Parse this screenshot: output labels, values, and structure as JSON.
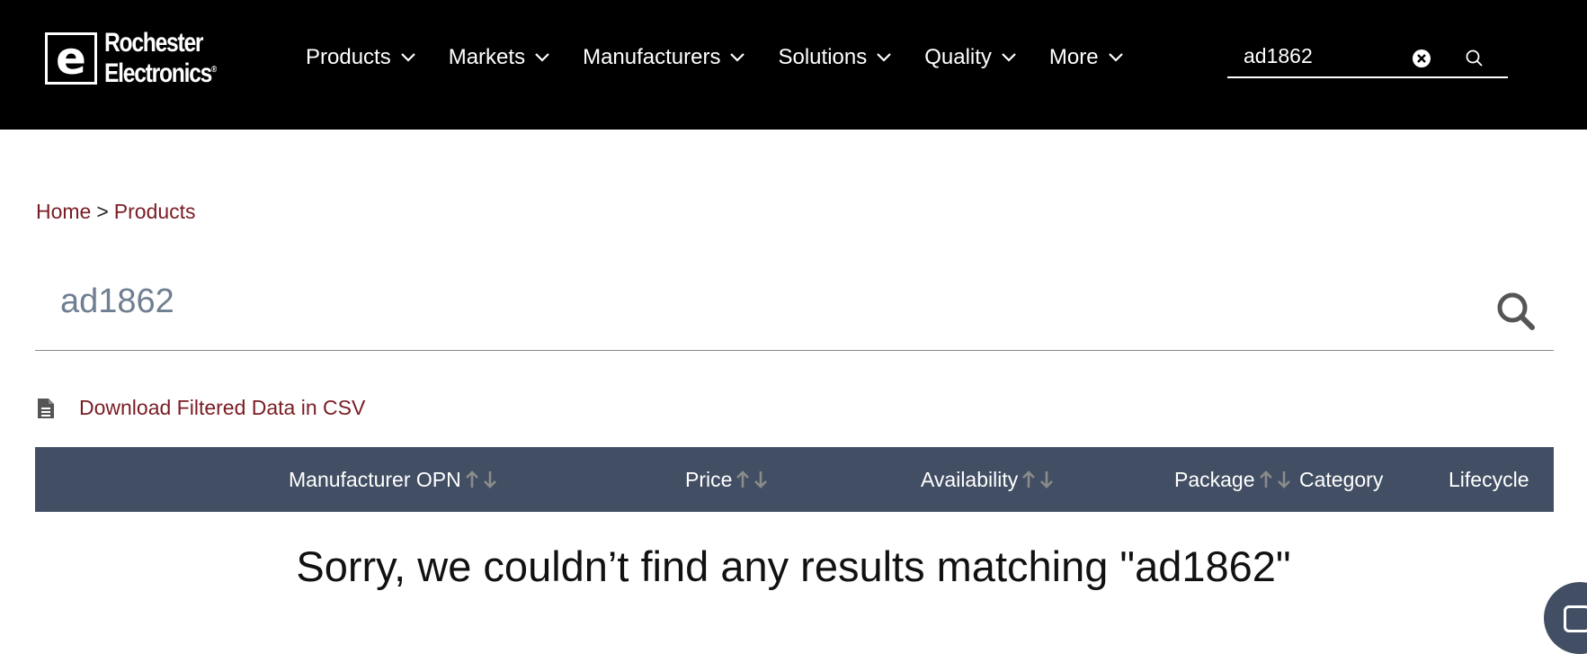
{
  "header": {
    "logo": {
      "line1": "Rochester",
      "line2": "Electronics",
      "mark": "e",
      "trademark": "®"
    },
    "nav": [
      {
        "label": "Products",
        "icon": "chevron-down-icon"
      },
      {
        "label": "Markets",
        "icon": "chevron-down-icon"
      },
      {
        "label": "Manufacturers",
        "icon": "chevron-down-icon"
      },
      {
        "label": "Solutions",
        "icon": "chevron-down-icon"
      },
      {
        "label": "Quality",
        "icon": "chevron-down-icon"
      },
      {
        "label": "More",
        "icon": "chevron-down-icon"
      }
    ],
    "search": {
      "value": "ad1862",
      "clear_icon": "clear-icon",
      "search_icon": "search-icon"
    }
  },
  "breadcrumb": {
    "home": "Home",
    "separator": ">",
    "current": "Products"
  },
  "main_search": {
    "value": "ad1862",
    "icon": "search-icon"
  },
  "download": {
    "label": "Download Filtered Data in CSV",
    "icon": "document-icon"
  },
  "table": {
    "columns": [
      {
        "label": "Manufacturer OPN",
        "sortable": true
      },
      {
        "label": "Price",
        "sortable": true
      },
      {
        "label": "Availability",
        "sortable": true
      },
      {
        "label": "Package",
        "sortable": true
      },
      {
        "label": "Category",
        "sortable": false
      },
      {
        "label": "Lifecycle",
        "sortable": false
      }
    ]
  },
  "no_results": {
    "message": "Sorry, we couldn’t find any results matching \"ad1862\""
  },
  "colors": {
    "header_bg": "#000000",
    "accent_link": "#7a1c24",
    "table_header_bg": "#424e63",
    "search_text": "#6f7f91"
  }
}
